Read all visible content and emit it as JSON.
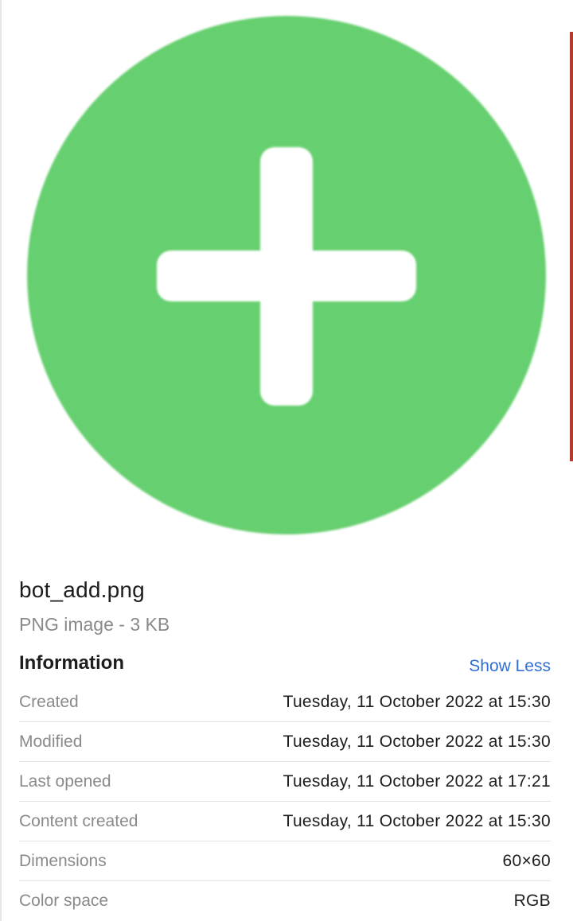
{
  "preview": {
    "icon": "plus-circle-icon",
    "circle_color": "#66cf6f",
    "plus_color": "#ffffff"
  },
  "file": {
    "name": "bot_add.png",
    "kind": "PNG image - 3 KB"
  },
  "info": {
    "title": "Information",
    "toggle_label": "Show Less",
    "rows": [
      {
        "label": "Created",
        "value": "Tuesday, 11 October 2022 at 15:30"
      },
      {
        "label": "Modified",
        "value": "Tuesday, 11 October 2022 at 15:30"
      },
      {
        "label": "Last opened",
        "value": "Tuesday, 11 October 2022 at 17:21"
      },
      {
        "label": "Content created",
        "value": "Tuesday, 11 October 2022 at 15:30"
      },
      {
        "label": "Dimensions",
        "value": "60×60"
      },
      {
        "label": "Color space",
        "value": "RGB"
      }
    ]
  }
}
